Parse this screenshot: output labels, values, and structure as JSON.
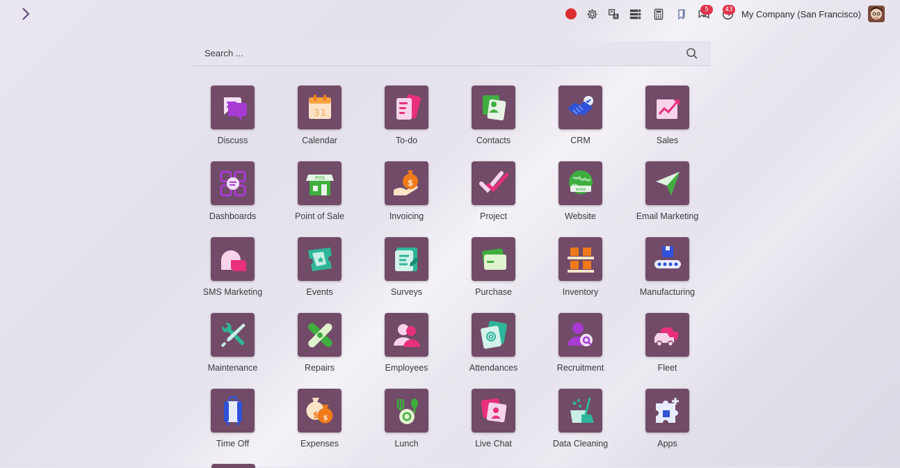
{
  "topbar": {
    "menu_toggle_icon": "chevron-right-icon",
    "systray": {
      "recording_color": "#d92f2f",
      "messages_badge": "5",
      "activities_badge": "43",
      "company_name": "My Company (San Francisco)"
    }
  },
  "search": {
    "placeholder": "Search ..."
  },
  "colors": {
    "tile": "#714b67",
    "accent": "#e0334a"
  },
  "apps": [
    {
      "label": "Discuss",
      "icon": "discuss-icon"
    },
    {
      "label": "Calendar",
      "icon": "calendar-icon"
    },
    {
      "label": "To-do",
      "icon": "todo-icon"
    },
    {
      "label": "Contacts",
      "icon": "contacts-icon"
    },
    {
      "label": "CRM",
      "icon": "crm-icon"
    },
    {
      "label": "Sales",
      "icon": "sales-icon"
    },
    {
      "label": "Dashboards",
      "icon": "dashboards-icon"
    },
    {
      "label": "Point of Sale",
      "icon": "point-of-sale-icon"
    },
    {
      "label": "Invoicing",
      "icon": "invoicing-icon"
    },
    {
      "label": "Project",
      "icon": "project-icon"
    },
    {
      "label": "Website",
      "icon": "website-icon"
    },
    {
      "label": "Email Marketing",
      "icon": "email-marketing-icon"
    },
    {
      "label": "SMS Marketing",
      "icon": "sms-marketing-icon"
    },
    {
      "label": "Events",
      "icon": "events-icon"
    },
    {
      "label": "Surveys",
      "icon": "surveys-icon"
    },
    {
      "label": "Purchase",
      "icon": "purchase-icon"
    },
    {
      "label": "Inventory",
      "icon": "inventory-icon"
    },
    {
      "label": "Manufacturing",
      "icon": "manufacturing-icon"
    },
    {
      "label": "Maintenance",
      "icon": "maintenance-icon"
    },
    {
      "label": "Repairs",
      "icon": "repairs-icon"
    },
    {
      "label": "Employees",
      "icon": "employees-icon"
    },
    {
      "label": "Attendances",
      "icon": "attendances-icon"
    },
    {
      "label": "Recruitment",
      "icon": "recruitment-icon"
    },
    {
      "label": "Fleet",
      "icon": "fleet-icon"
    },
    {
      "label": "Time Off",
      "icon": "time-off-icon"
    },
    {
      "label": "Expenses",
      "icon": "expenses-icon"
    },
    {
      "label": "Lunch",
      "icon": "lunch-icon"
    },
    {
      "label": "Live Chat",
      "icon": "live-chat-icon"
    },
    {
      "label": "Data Cleaning",
      "icon": "data-cleaning-icon"
    },
    {
      "label": "Apps",
      "icon": "apps-icon"
    }
  ]
}
